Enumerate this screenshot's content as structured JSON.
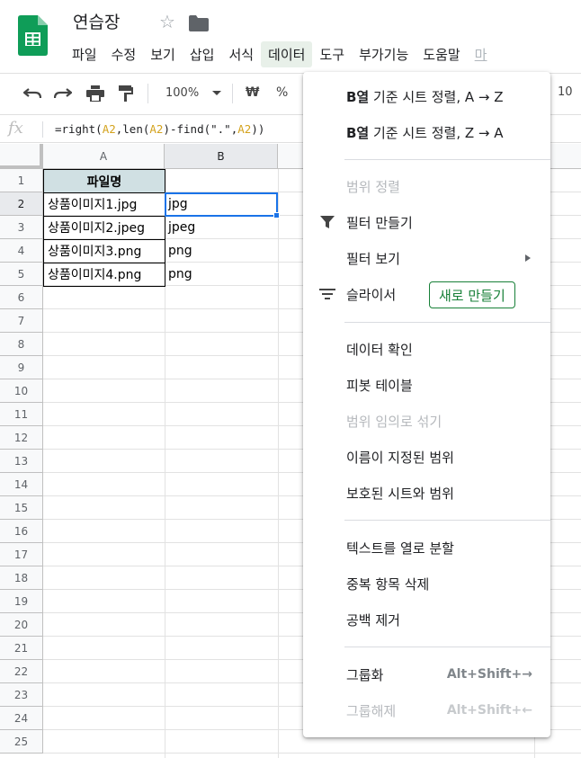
{
  "header": {
    "title": "연습장",
    "menus": [
      "파일",
      "수정",
      "보기",
      "삽입",
      "서식",
      "데이터",
      "도구",
      "부가기능",
      "도움말",
      "마"
    ]
  },
  "toolbar": {
    "zoom": "100%",
    "currency": "₩",
    "percent": "%",
    "font_size_fragment": "10"
  },
  "formula_bar": {
    "fx": "fx",
    "parts": [
      "=right(",
      "A2",
      ",len(",
      "A2",
      ")-find(\".\",",
      "A2",
      "))"
    ]
  },
  "grid": {
    "columns": [
      "A",
      "B"
    ],
    "rows": [
      "1",
      "2",
      "3",
      "4",
      "5",
      "6",
      "7",
      "8",
      "9",
      "10",
      "11",
      "12",
      "13",
      "14",
      "15",
      "16",
      "17",
      "18",
      "19",
      "20",
      "21",
      "22",
      "23",
      "24",
      "25"
    ],
    "header_cell": "파일명",
    "data": [
      {
        "a": "상품이미지1.jpg",
        "b": "jpg"
      },
      {
        "a": "상품이미지2.jpeg",
        "b": "jpeg"
      },
      {
        "a": "상품이미지3.png",
        "b": "png"
      },
      {
        "a": "상품이미지4.png",
        "b": "png"
      }
    ]
  },
  "data_menu": {
    "sort_asc_bold": "B열",
    "sort_asc_rest": " 기준 시트 정렬, A → Z",
    "sort_desc_bold": "B열",
    "sort_desc_rest": " 기준 시트 정렬, Z → A",
    "sort_range": "범위 정렬",
    "create_filter": "필터 만들기",
    "filter_views": "필터 보기",
    "slicer": "슬라이서",
    "new_button": "새로 만들기",
    "data_validation": "데이터 확인",
    "pivot_table": "피봇 테이블",
    "randomize_range": "범위 임의로 섞기",
    "named_ranges": "이름이 지정된 범위",
    "protected": "보호된 시트와 범위",
    "split_text": "텍스트를 열로 분할",
    "remove_duplicates": "중복 항목 삭제",
    "trim_whitespace": "공백 제거",
    "group": "그룹화",
    "group_shortcut": "Alt+Shift+→",
    "ungroup": "그룹해제",
    "ungroup_shortcut": "Alt+Shift+←"
  }
}
